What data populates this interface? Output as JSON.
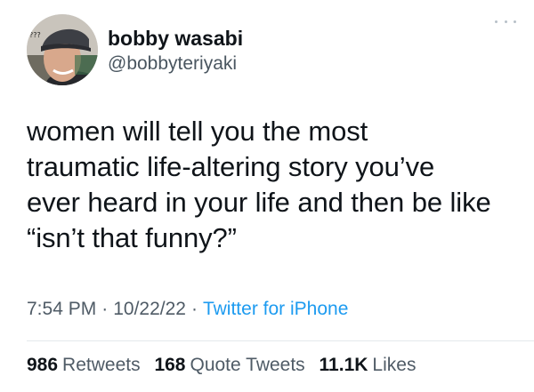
{
  "author": {
    "display_name": "bobby wasabi",
    "handle": "@bobbyteriyaki",
    "avatar_overlay_text": "???"
  },
  "tweet": {
    "lines": [
      "women will tell you the most",
      "traumatic life-altering story you’ve",
      "ever heard in your life and then be like",
      "“isn’t that funny?”"
    ],
    "time": "7:54 PM",
    "separator": "·",
    "date": "10/22/22",
    "source": "Twitter for iPhone"
  },
  "stats": {
    "retweets": {
      "count": "986",
      "label": "Retweets"
    },
    "quote_tweets": {
      "count": "168",
      "label": "Quote Tweets"
    },
    "likes": {
      "count": "11.1K",
      "label": "Likes"
    }
  },
  "icons": {
    "more": "more-horizontal-icon"
  },
  "colors": {
    "link": "#1d9bf0",
    "text": "#0f1419",
    "secondary": "#4f5b66"
  }
}
